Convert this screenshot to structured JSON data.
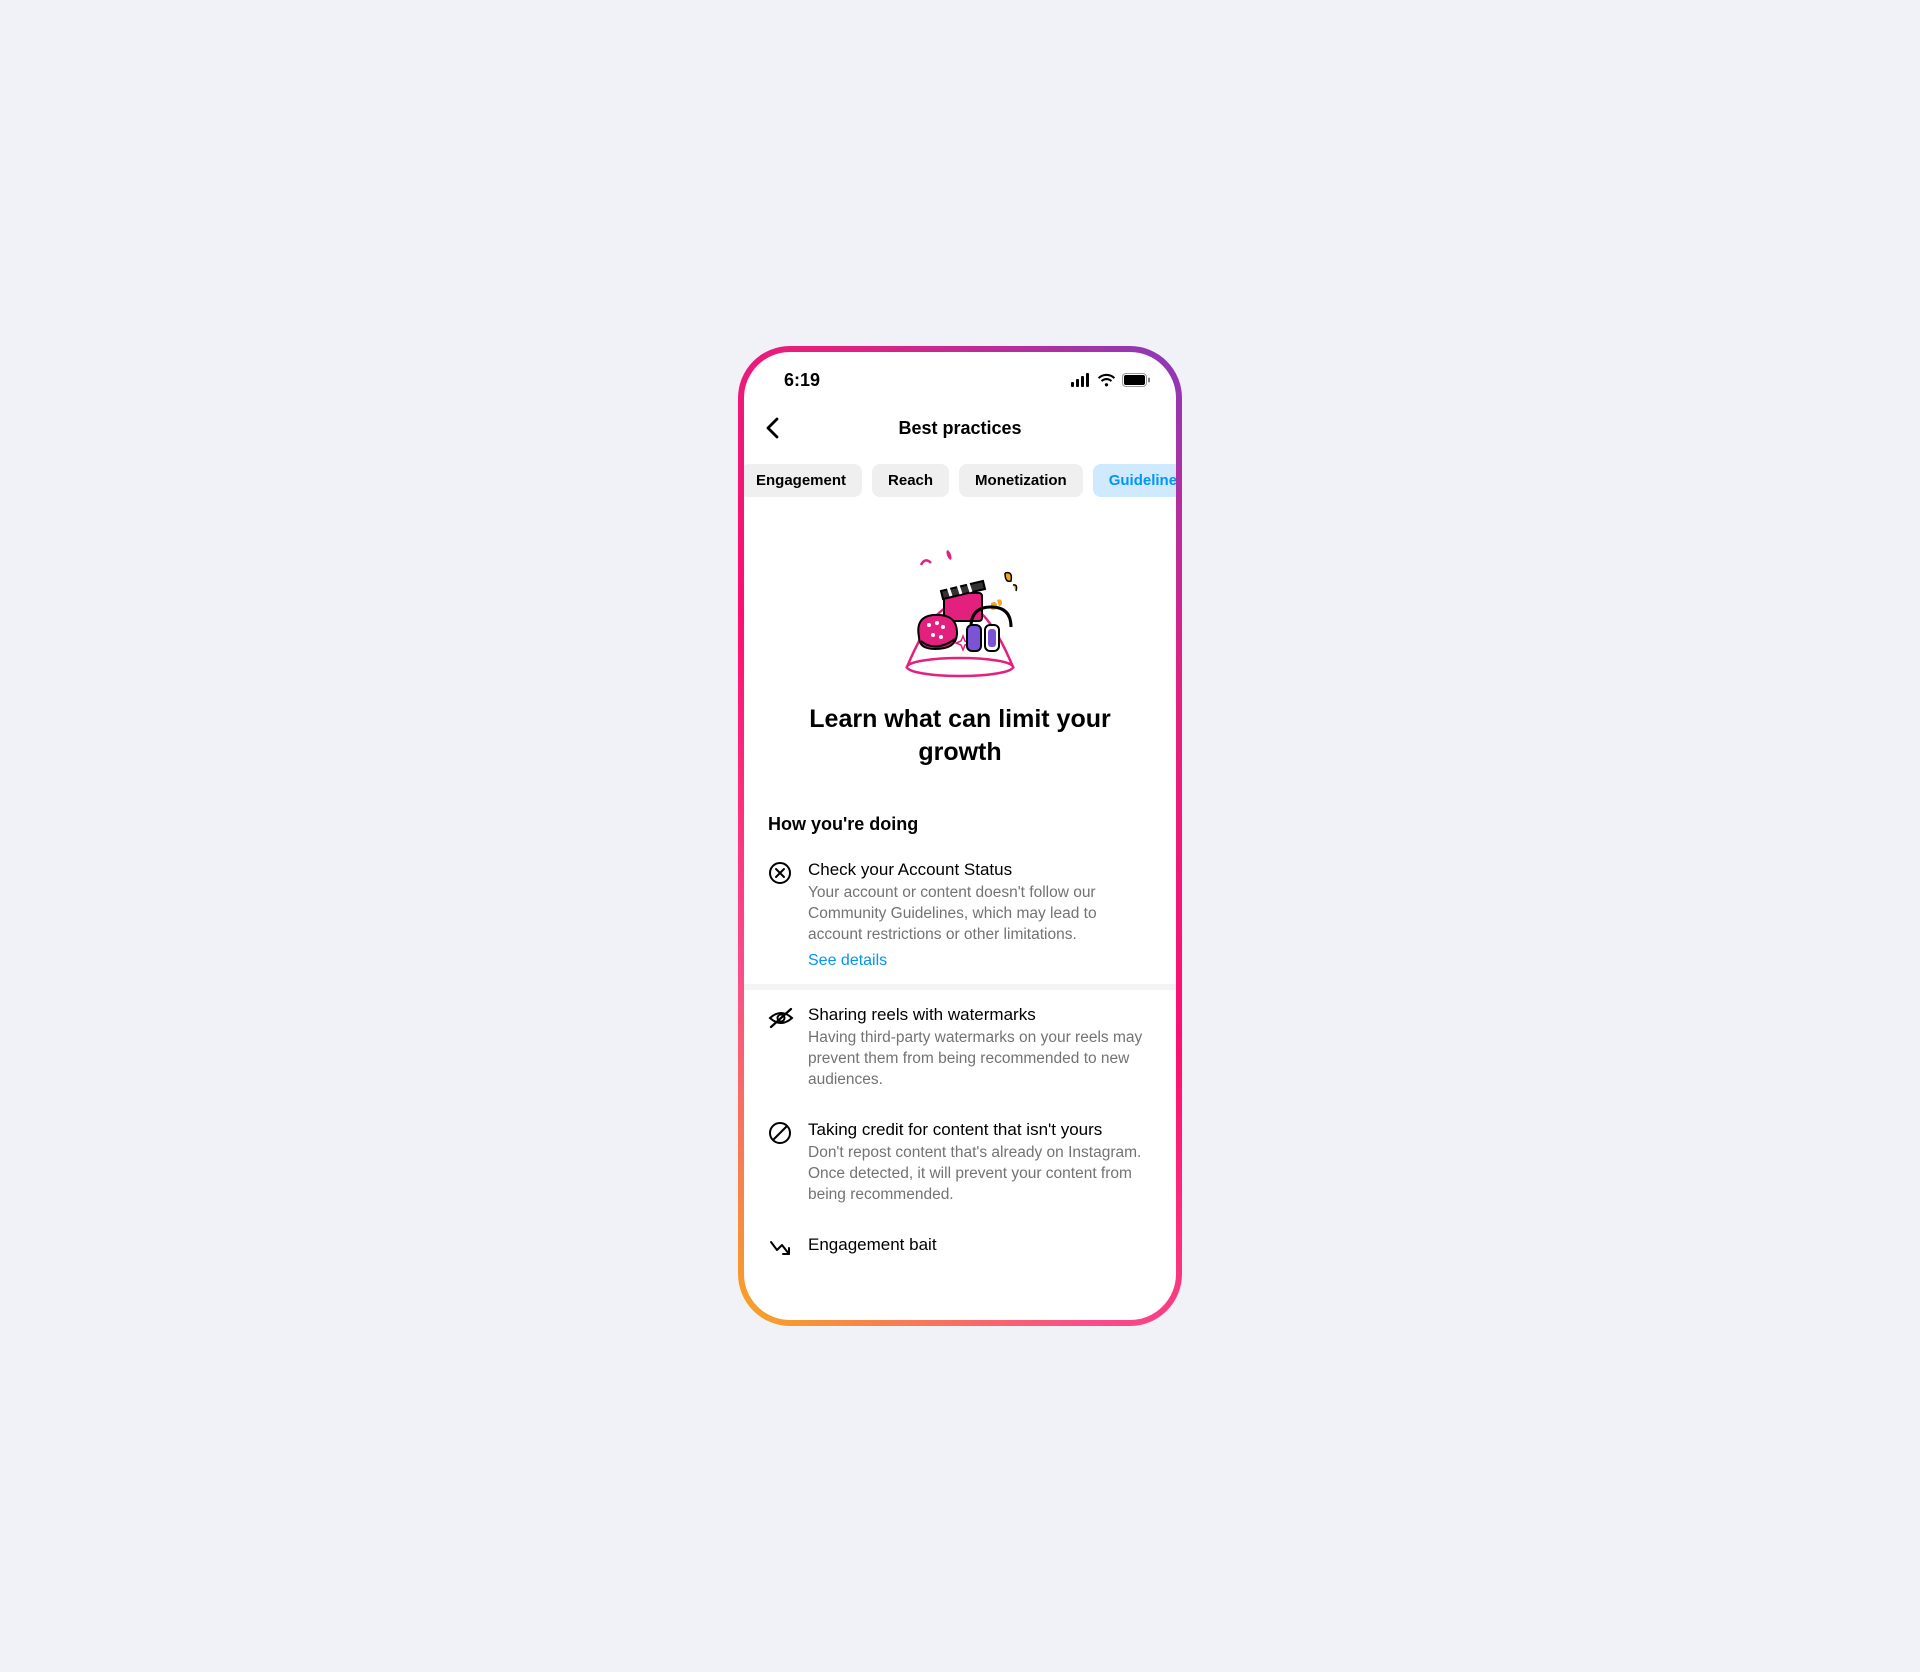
{
  "status_bar": {
    "time": "6:19"
  },
  "nav": {
    "title": "Best practices"
  },
  "tabs": [
    {
      "label": "Engagement",
      "active": false
    },
    {
      "label": "Reach",
      "active": false
    },
    {
      "label": "Monetization",
      "active": false
    },
    {
      "label": "Guidelines",
      "active": true
    }
  ],
  "hero": {
    "title": "Learn what can limit your growth"
  },
  "section": {
    "heading": "How you're doing",
    "items": [
      {
        "icon": "error-circle-icon",
        "title": "Check your Account Status",
        "desc": "Your account or content doesn't follow our Community Guidelines, which may lead to account restrictions or other limitations.",
        "link": "See details"
      }
    ],
    "more_items": [
      {
        "icon": "eye-off-icon",
        "title": "Sharing reels with watermarks",
        "desc": "Having third-party watermarks on your reels may prevent them from being recommended to new audiences."
      },
      {
        "icon": "block-icon",
        "title": "Taking credit for content that isn't yours",
        "desc": "Don't repost content that's already on Instagram. Once detected, it will prevent your content from being recommended."
      },
      {
        "icon": "trend-down-icon",
        "title": "Engagement bait",
        "desc": ""
      }
    ]
  }
}
